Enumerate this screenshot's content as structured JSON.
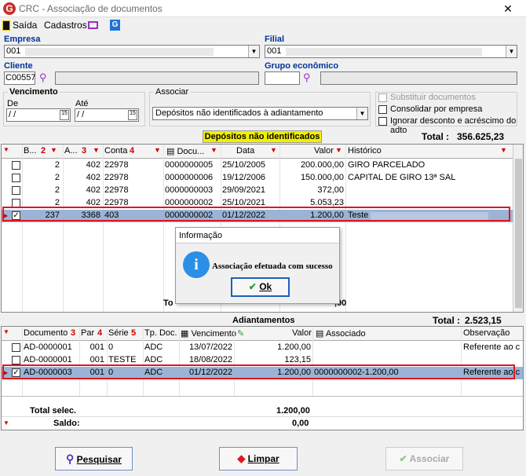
{
  "window": {
    "title": "CRC - Associação de documentos",
    "close": "✕"
  },
  "menu": {
    "exit": "Saída",
    "registrations": "Cadastros"
  },
  "filters": {
    "empresa_label": "Empresa",
    "empresa_value": "001",
    "filial_label": "Filial",
    "filial_value": "001",
    "cliente_label": "Cliente",
    "cliente_value": "C00557",
    "grupo_label": "Grupo econômico",
    "vencimento_label": "Vencimento",
    "de_label": "De",
    "ate_label": "Até",
    "de_value": " / /",
    "ate_value": " / /",
    "associar_label": "Associar",
    "associar_value": "Depósitos não identificados à adiantamento",
    "substituir": "Substituir documentos",
    "consolidar": "Consolidar por empresa",
    "ignorar": "Ignorar desconto e acréscimo do adto"
  },
  "deposits": {
    "title": "Depósitos não identificados",
    "total_label": "Total :",
    "total_value": "356.625,23",
    "headers": {
      "b": "B...",
      "b_num": "2",
      "a": "A...",
      "a_num": "3",
      "conta": "Conta",
      "conta_num": "4",
      "documento": "Docu...",
      "data": "Data",
      "valor": "Valor",
      "historico": "Histórico"
    },
    "rows": [
      {
        "b": "2",
        "a": "402",
        "conta": "22978",
        "doc": "0000000005",
        "data": "25/10/2005",
        "valor": "200.000,00",
        "hist": "GIRO PARCELADO",
        "checked": false
      },
      {
        "b": "2",
        "a": "402",
        "conta": "22978",
        "doc": "0000000006",
        "data": "19/12/2006",
        "valor": "150.000,00",
        "hist": "CAPITAL DE GIRO 13ª SAL",
        "checked": false
      },
      {
        "b": "2",
        "a": "402",
        "conta": "22978",
        "doc": "0000000003",
        "data": "29/09/2021",
        "valor": "372,00",
        "hist": "",
        "checked": false
      },
      {
        "b": "2",
        "a": "402",
        "conta": "22978",
        "doc": "0000000002",
        "data": "25/10/2021",
        "valor": "5.053,23",
        "hist": "",
        "checked": false
      },
      {
        "b": "237",
        "a": "3368",
        "conta": "403",
        "doc": "0000000002",
        "data": "01/12/2022",
        "valor": "1.200,00",
        "hist": "Teste",
        "checked": true
      }
    ],
    "footer_fragment_left": "To",
    "footer_fragment_right": ",00"
  },
  "dialog": {
    "title": "Informação",
    "message": "Associação efetuada com sucesso",
    "ok": "Ok",
    "icon": "i"
  },
  "advances": {
    "title": "Adiantamentos",
    "total_label": "Total :",
    "total_value": "2.523,15",
    "headers": {
      "documento": "Documento",
      "documento_num": "3",
      "par": "Par",
      "par_num": "4",
      "serie": "Série",
      "serie_num": "5",
      "tipo": "Tp. Doc.",
      "vencimento": "Vencimento",
      "valor": "Valor",
      "associado": "Associado",
      "observacao": "Observação"
    },
    "rows": [
      {
        "doc": "AD-0000001",
        "par": "001",
        "serie": "0",
        "tipo": "ADC",
        "venc": "13/07/2022",
        "valor": "1.200,00",
        "assoc": "",
        "obs": "Referente ao c",
        "checked": false
      },
      {
        "doc": "AD-0000001",
        "par": "001",
        "serie": "TESTE",
        "tipo": "ADC",
        "venc": "18/08/2022",
        "valor": "123,15",
        "assoc": "",
        "obs": "",
        "checked": false
      },
      {
        "doc": "AD-0000003",
        "par": "001",
        "serie": "0",
        "tipo": "ADC",
        "venc": "01/12/2022",
        "valor": "1.200,00",
        "assoc": "0000000002-1.200,00",
        "obs": "Referente ao c",
        "checked": true
      }
    ],
    "total_selec_label": "Total selec.",
    "total_selec_value": "1.200,00",
    "saldo_label": "Saldo:",
    "saldo_value": "0,00"
  },
  "buttons": {
    "search": "Pesquisar",
    "clear": "Limpar",
    "associate": "Associar"
  },
  "colors": {
    "label_blue": "#003399",
    "highlight": "#e0161e",
    "selected_row": "#9bb4d6",
    "title_yellow": "#f2f000"
  }
}
